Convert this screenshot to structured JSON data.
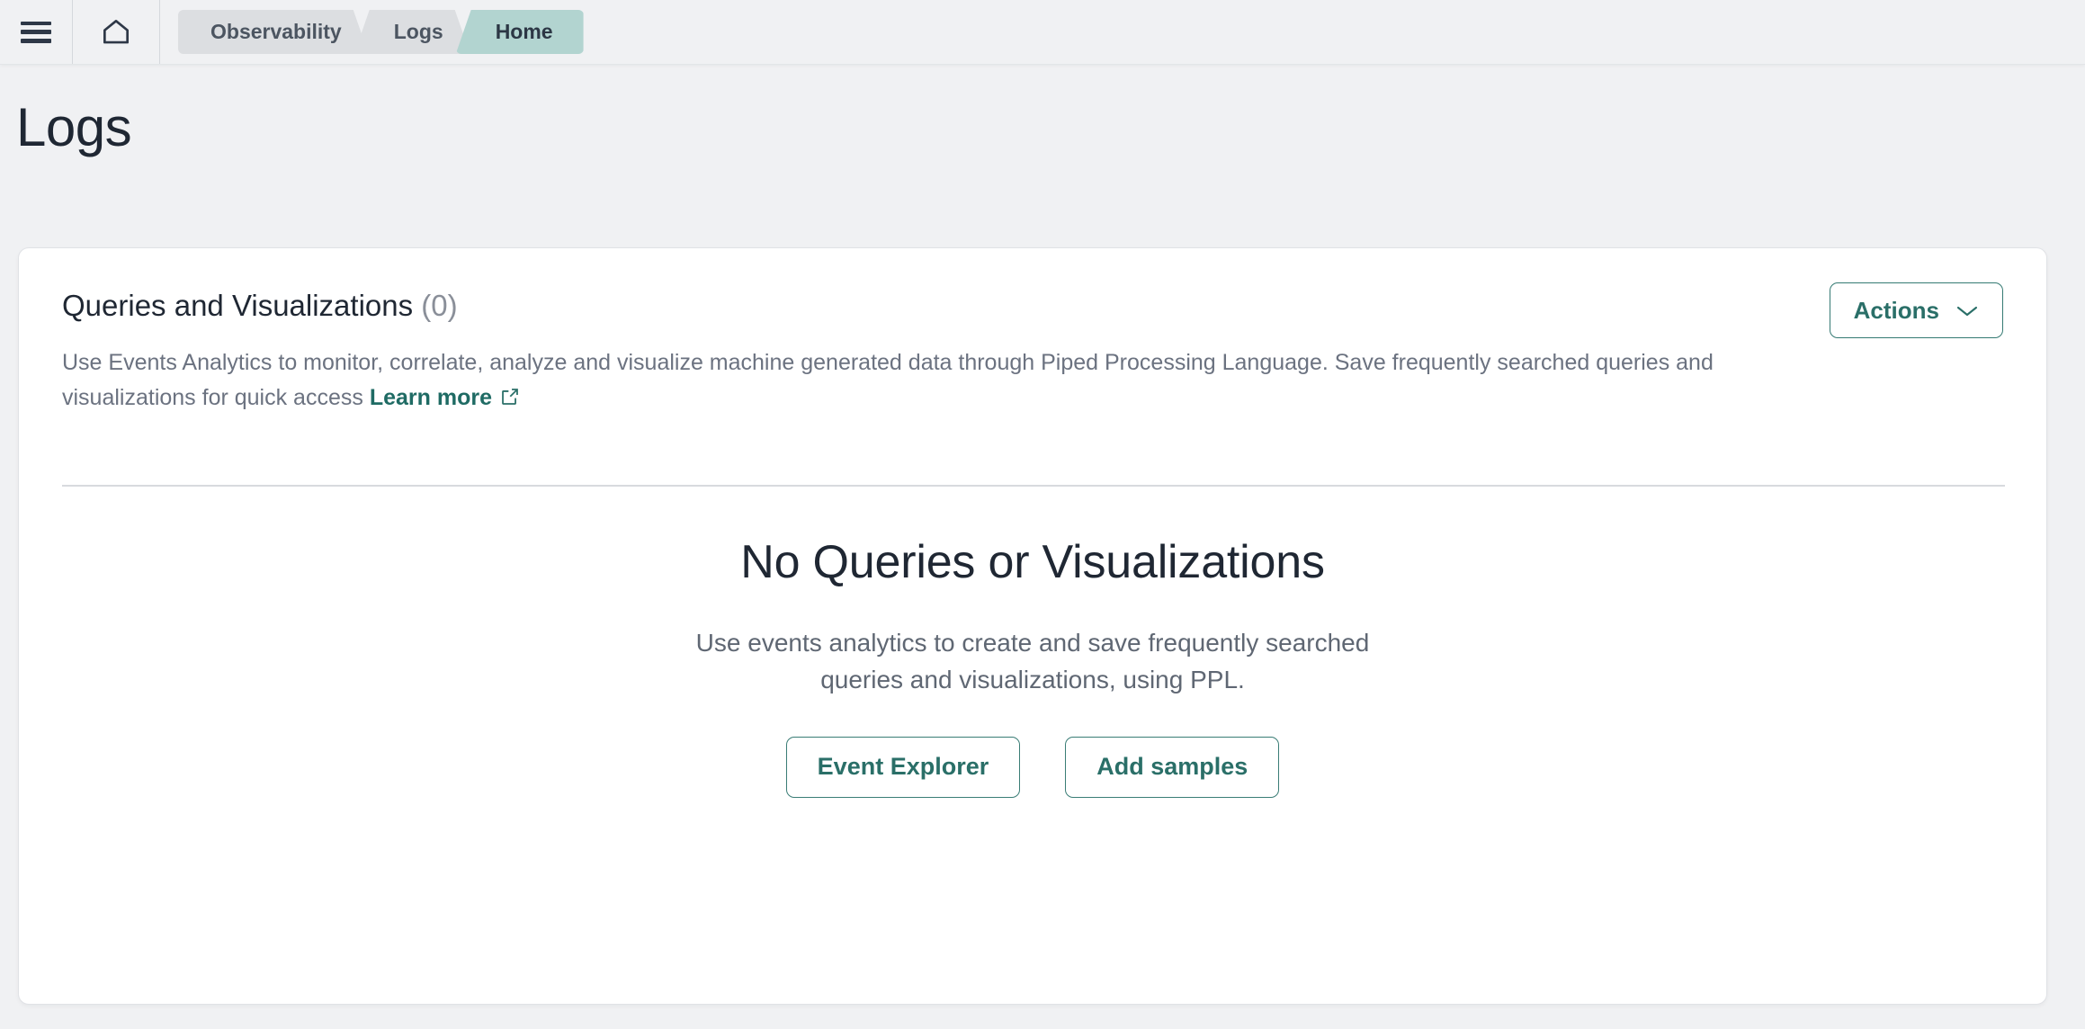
{
  "topbar": {
    "menu_icon": "hamburger-menu-icon",
    "home_icon": "home-icon",
    "breadcrumbs": [
      {
        "label": "Observability",
        "active": false
      },
      {
        "label": "Logs",
        "active": false
      },
      {
        "label": "Home",
        "active": true
      }
    ]
  },
  "page": {
    "title": "Logs"
  },
  "card": {
    "title": "Queries and Visualizations",
    "count": "(0)",
    "description_part1": "Use Events Analytics to monitor, correlate, analyze and visualize machine generated data through Piped Processing Language. Save frequently searched queries and visualizations for quick access ",
    "learn_more_label": "Learn more",
    "external_link_icon": "external-link-icon",
    "actions_label": "Actions",
    "actions_chevron_icon": "chevron-down-icon"
  },
  "empty_state": {
    "title": "No Queries or Visualizations",
    "body": "Use events analytics to create and save frequently searched queries and visualizations, using PPL.",
    "primary_button": "Event Explorer",
    "secondary_button": "Add samples"
  },
  "colors": {
    "accent_teal": "#2a6f68",
    "breadcrumb_active_bg": "#b2d4d0",
    "breadcrumb_bg": "#dcdee1",
    "page_bg": "#f0f1f3",
    "card_bg": "#ffffff",
    "text_dark": "#1f2733",
    "text_muted": "#6b7280"
  }
}
